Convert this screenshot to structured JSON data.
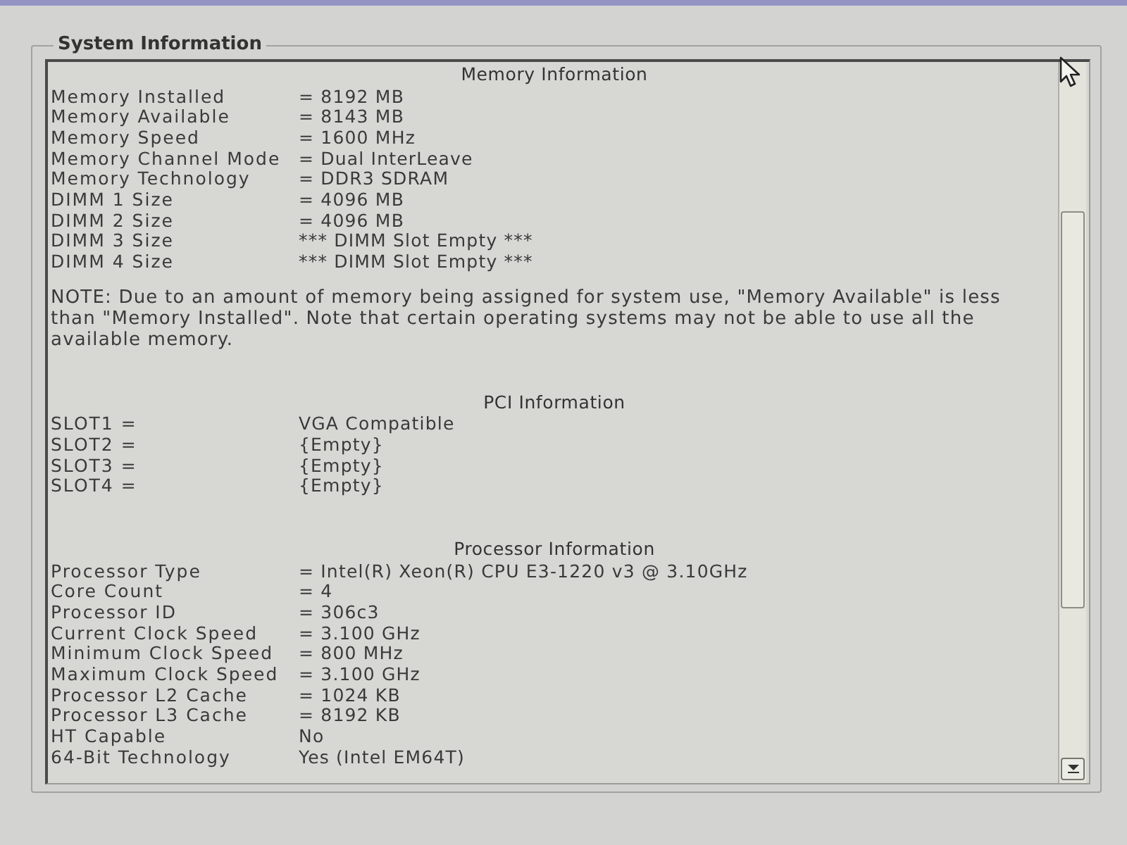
{
  "group_box": {
    "title": "System Information"
  },
  "sections": [
    {
      "title": "Memory Information",
      "rows": [
        {
          "label": "Memory Installed",
          "value": "= 8192 MB"
        },
        {
          "label": "Memory Available",
          "value": "= 8143 MB"
        },
        {
          "label": "Memory Speed",
          "value": "= 1600 MHz"
        },
        {
          "label": "Memory Channel Mode",
          "value": "= Dual InterLeave"
        },
        {
          "label": "Memory Technology",
          "value": "= DDR3 SDRAM"
        },
        {
          "label": "DIMM 1 Size",
          "value": "= 4096 MB"
        },
        {
          "label": "DIMM 2 Size",
          "value": "= 4096 MB"
        },
        {
          "label": "DIMM 3 Size",
          "value": "*** DIMM Slot Empty ***"
        },
        {
          "label": "DIMM 4 Size",
          "value": "*** DIMM Slot Empty ***"
        }
      ],
      "note": "NOTE: Due to an amount of memory being assigned for system use, \"Memory Available\" is less than \"Memory Installed\". Note that certain operating systems may not be able to use all the available memory."
    },
    {
      "title": "PCI Information",
      "rows": [
        {
          "label": "SLOT1 =",
          "value": "VGA Compatible"
        },
        {
          "label": "SLOT2 =",
          "value": "{Empty}"
        },
        {
          "label": "SLOT3 =",
          "value": "{Empty}"
        },
        {
          "label": "SLOT4 =",
          "value": "{Empty}"
        }
      ]
    },
    {
      "title": "Processor Information",
      "rows": [
        {
          "label": "Processor Type",
          "value": "= Intel(R) Xeon(R) CPU E3-1220 v3 @ 3.10GHz"
        },
        {
          "label": "Core Count",
          "value": "= 4"
        },
        {
          "label": "Processor ID",
          "value": "= 306c3"
        },
        {
          "label": "Current Clock Speed",
          "value": "= 3.100 GHz"
        },
        {
          "label": "Minimum Clock Speed",
          "value": "= 800 MHz"
        },
        {
          "label": "Maximum Clock Speed",
          "value": "= 3.100 GHz"
        },
        {
          "label": "Processor L2 Cache",
          "value": "= 1024 KB"
        },
        {
          "label": "Processor L3 Cache",
          "value": "= 8192 KB"
        },
        {
          "label": "HT Capable",
          "value": "No"
        },
        {
          "label": "64-Bit Technology",
          "value": "Yes (Intel EM64T)"
        }
      ]
    }
  ]
}
